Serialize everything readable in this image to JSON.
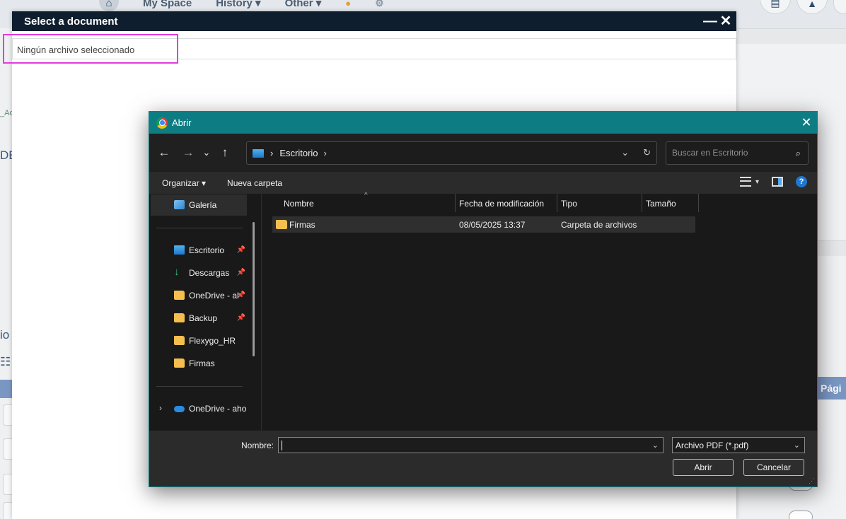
{
  "background": {
    "nav": [
      "My Space",
      "History ▾",
      "Other ▾"
    ],
    "pagina_label": "Pági",
    "left_fragments": [
      "_Ac",
      "DE",
      "io"
    ]
  },
  "modal": {
    "title": "Select a document",
    "minimize": "—",
    "close": "✕",
    "file_status": "Ningún archivo seleccionado"
  },
  "dialog": {
    "title": "Abrir",
    "close": "✕",
    "nav_buttons": {
      "back": "←",
      "forward": "→",
      "recent": "⌄",
      "up": "↑"
    },
    "address": {
      "chevron_left": "›",
      "location": "Escritorio",
      "chevron_right": "›",
      "dropdown": "⌄",
      "refresh": "↻"
    },
    "search": {
      "placeholder": "Buscar en Escritorio",
      "icon": "⌕"
    },
    "toolbar": {
      "organize": "Organizar ▾",
      "new_folder": "Nueva carpeta",
      "view_dropdown": "▾",
      "help": "?"
    },
    "nav_pane": {
      "gallery": "Galería",
      "quick_access": [
        {
          "label": "Escritorio",
          "pinned": true,
          "icon": "desktop-icon"
        },
        {
          "label": "Descargas",
          "pinned": true,
          "icon": "download-icon"
        },
        {
          "label": "OneDrive - al",
          "pinned": true,
          "icon": "folder-icon"
        },
        {
          "label": "Backup",
          "pinned": true,
          "icon": "folder-icon"
        },
        {
          "label": "Flexygo_HR",
          "pinned": false,
          "icon": "folder-icon"
        },
        {
          "label": "Firmas",
          "pinned": false,
          "icon": "folder-icon"
        }
      ],
      "onedrive": "OneDrive - ahor",
      "pin_glyph": "📌",
      "expand_glyph": "›"
    },
    "columns": {
      "name": "Nombre",
      "modified": "Fecha de modificación",
      "type": "Tipo",
      "size": "Tamaño",
      "sort_caret": "^"
    },
    "files": [
      {
        "name": "Firmas",
        "modified": "08/05/2025 13:37",
        "type": "Carpeta de archivos",
        "size": ""
      }
    ],
    "footer": {
      "filename_label": "Nombre:",
      "filename_value": "",
      "filename_chevron": "⌄",
      "filetype": "Archivo PDF (*.pdf)",
      "filetype_chevron": "⌄",
      "open_button": "Abrir",
      "cancel_button": "Cancelar",
      "grip": "⋰"
    }
  },
  "colors": {
    "dialog_title_bar": "#0e7c83",
    "modal_header": "#0f1e2e",
    "highlight": "#e43be0"
  }
}
